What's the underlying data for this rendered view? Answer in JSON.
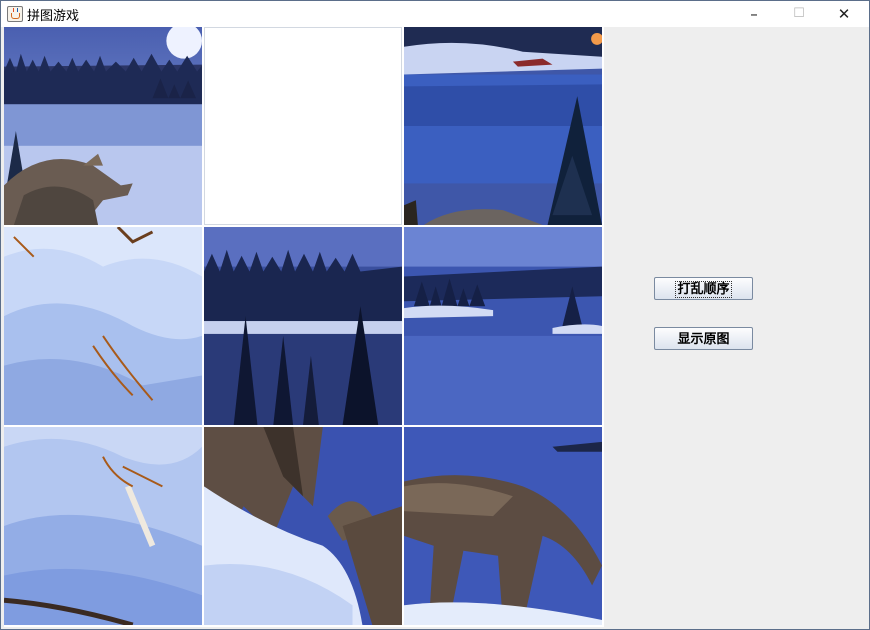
{
  "window": {
    "title": "拼图游戏",
    "min_label": "–",
    "max_label": "☐",
    "close_label": "✕"
  },
  "tiles": [
    {
      "name": "puzzle-tile-0",
      "piece": "moon-lake-wolf-head"
    },
    {
      "name": "puzzle-tile-1",
      "piece": "blank"
    },
    {
      "name": "puzzle-tile-2",
      "piece": "lake-reflection-pine"
    },
    {
      "name": "puzzle-tile-3",
      "piece": "snow-bank-dry-grass"
    },
    {
      "name": "puzzle-tile-4",
      "piece": "forest-island-lake"
    },
    {
      "name": "puzzle-tile-5",
      "piece": "lake-island-snow"
    },
    {
      "name": "puzzle-tile-6",
      "piece": "snow-branch"
    },
    {
      "name": "puzzle-tile-7",
      "piece": "wolf-legs-snow"
    },
    {
      "name": "puzzle-tile-8",
      "piece": "wolf-walking"
    }
  ],
  "controls": {
    "shuffle_label": "打乱顺序",
    "show_original_label": "显示原图"
  }
}
